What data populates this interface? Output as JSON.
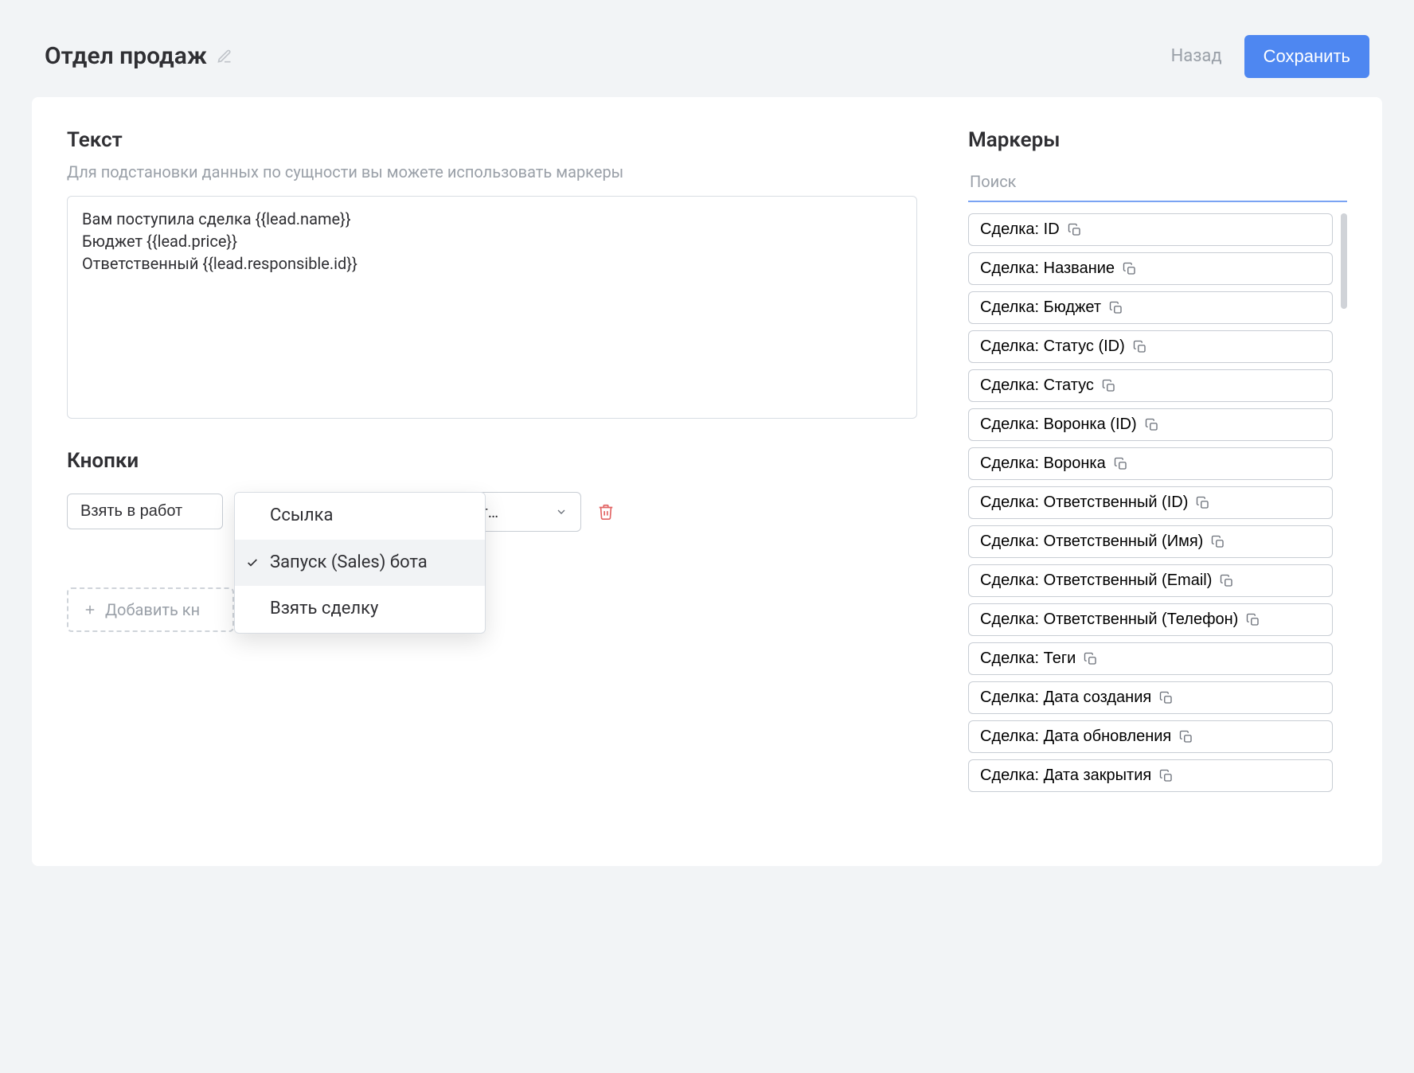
{
  "header": {
    "title": "Отдел продаж",
    "back_label": "Назад",
    "save_label": "Сохранить"
  },
  "text_section": {
    "title": "Текст",
    "hint": "Для подстановки данных по сущности вы можете использовать маркеры",
    "value": "Вам поступила сделка {{lead.name}}\nБюджет {{lead.price}}\nОтветственный {{lead.responsible.id}}"
  },
  "buttons_section": {
    "title": "Кнопки",
    "chip_label": "Взять в работ",
    "select_placeholder": "бирайт…",
    "add_label": "Добавить кн",
    "dropdown": {
      "selected_index": 1,
      "items": [
        "Ссылка",
        "Запуск (Sales) бота",
        "Взять сделку"
      ]
    }
  },
  "markers": {
    "title": "Маркеры",
    "search_placeholder": "Поиск",
    "items": [
      "Сделка: ID",
      "Сделка: Название",
      "Сделка: Бюджет",
      "Сделка: Статус (ID)",
      "Сделка: Статус",
      "Сделка: Воронка (ID)",
      "Сделка: Воронка",
      "Сделка: Ответственный (ID)",
      "Сделка: Ответственный (Имя)",
      "Сделка: Ответственный (Email)",
      "Сделка: Ответственный (Телефон)",
      "Сделка: Теги",
      "Сделка: Дата создания",
      "Сделка: Дата обновления",
      "Сделка: Дата закрытия"
    ]
  }
}
